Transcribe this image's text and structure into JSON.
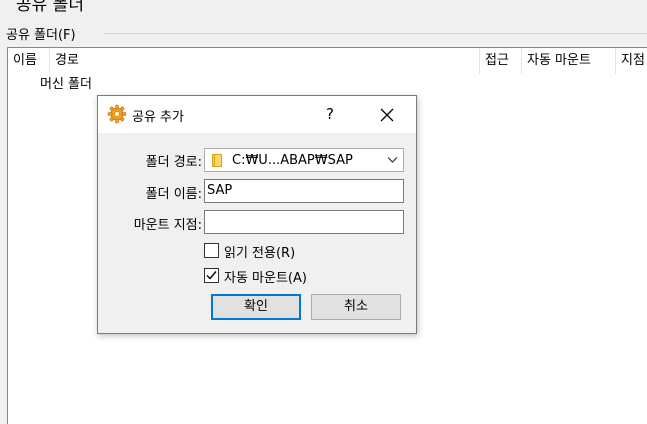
{
  "window": {
    "title": "공유 폴더"
  },
  "group": {
    "label": "공유 폴더(F)"
  },
  "list": {
    "columns": [
      "이름",
      "경로",
      "접근",
      "자동 마운트",
      "지점"
    ],
    "rows": [
      {
        "name": "머신 폴더"
      }
    ]
  },
  "dialog": {
    "title": "공유 추가",
    "help_label": "?",
    "icon": "gear-icon",
    "close_icon": "close-icon",
    "fields": {
      "path_label": "폴더 경로:",
      "path_value": "C:₩U...ABAP₩SAP",
      "name_label": "폴더 이름:",
      "name_value": "SAP",
      "mount_label": "마운트 지점:",
      "mount_value": ""
    },
    "checkboxes": {
      "readonly_label": "읽기 전용(R)",
      "readonly_checked": false,
      "automount_label": "자동 마운트(A)",
      "automount_checked": true
    },
    "buttons": {
      "ok_label": "확인",
      "cancel_label": "취소"
    }
  },
  "colors": {
    "accent": "#0078d7",
    "dialog_bg": "#f0f0f0",
    "folder": "#f6c343"
  }
}
